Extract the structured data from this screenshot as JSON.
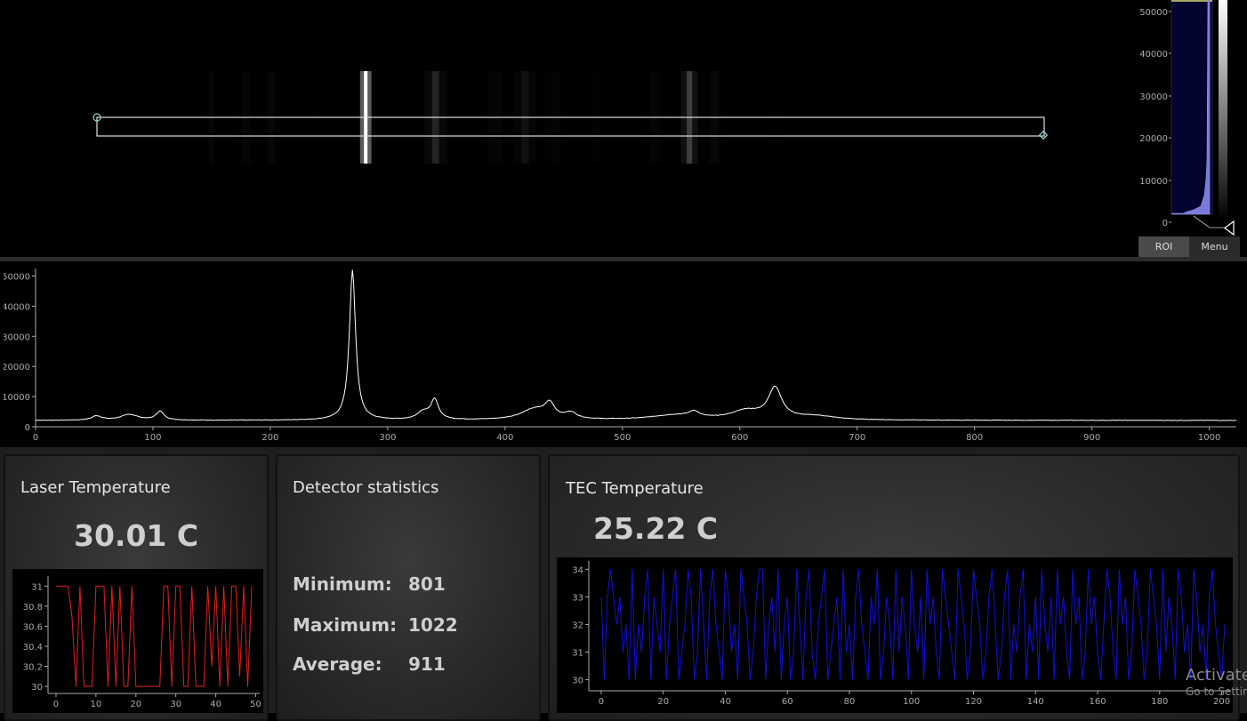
{
  "image_view": {
    "bands": [
      {
        "pos": 0.155,
        "w": 6,
        "i": 0.12
      },
      {
        "pos": 0.19,
        "w": 10,
        "i": 0.1
      },
      {
        "pos": 0.215,
        "w": 8,
        "i": 0.12
      },
      {
        "pos": 0.26,
        "w": 8,
        "i": 0.04
      },
      {
        "pos": 0.31,
        "w": 4,
        "i": 1.0
      },
      {
        "pos": 0.38,
        "w": 8,
        "i": 0.3
      },
      {
        "pos": 0.44,
        "w": 14,
        "i": 0.1
      },
      {
        "pos": 0.47,
        "w": 8,
        "i": 0.2
      },
      {
        "pos": 0.5,
        "w": 10,
        "i": 0.08
      },
      {
        "pos": 0.54,
        "w": 12,
        "i": 0.06
      },
      {
        "pos": 0.6,
        "w": 10,
        "i": 0.08
      },
      {
        "pos": 0.635,
        "w": 6,
        "i": 0.42
      },
      {
        "pos": 0.66,
        "w": 10,
        "i": 0.12
      },
      {
        "pos": 0.72,
        "w": 20,
        "i": 0.04
      }
    ]
  },
  "histogram": {
    "ticks": [
      "50000",
      "40000",
      "30000",
      "20000",
      "10000",
      "0"
    ],
    "roi_label": "ROI",
    "menu_label": "Menu",
    "accent": "#0a0a3a"
  },
  "chart_data": [
    {
      "type": "line",
      "id": "spectrum",
      "xlim": [
        0,
        1023
      ],
      "ylim": [
        0,
        52500
      ],
      "xticks": [
        0,
        100,
        200,
        300,
        400,
        500,
        600,
        700,
        800,
        900,
        1000
      ],
      "yticks": [
        0,
        10000,
        20000,
        30000,
        40000,
        50000
      ],
      "color": "#ffffff",
      "baseline": 2100,
      "peaks": [
        {
          "x": 52,
          "h": 1400,
          "w": 5
        },
        {
          "x": 80,
          "h": 1900,
          "w": 9
        },
        {
          "x": 106,
          "h": 2900,
          "w": 4
        },
        {
          "x": 270,
          "h": 49800,
          "w": 3.2
        },
        {
          "x": 330,
          "h": 2500,
          "w": 6
        },
        {
          "x": 340,
          "h": 6500,
          "w": 4
        },
        {
          "x": 425,
          "h": 3500,
          "w": 14
        },
        {
          "x": 438,
          "h": 4500,
          "w": 5
        },
        {
          "x": 456,
          "h": 2000,
          "w": 6
        },
        {
          "x": 545,
          "h": 1600,
          "w": 25
        },
        {
          "x": 561,
          "h": 1800,
          "w": 5
        },
        {
          "x": 605,
          "h": 2800,
          "w": 15
        },
        {
          "x": 630,
          "h": 10200,
          "w": 7
        },
        {
          "x": 665,
          "h": 1200,
          "w": 20
        }
      ]
    },
    {
      "type": "line",
      "id": "laser-temperature",
      "xlim": [
        -2,
        51
      ],
      "ylim": [
        29.93,
        31.1
      ],
      "xticks": [
        0,
        10,
        20,
        30,
        40,
        50
      ],
      "yticks": [
        30,
        30.2,
        30.4,
        30.6,
        30.8,
        31
      ],
      "yticklabels": [
        "30",
        "30.2",
        "30.4",
        "30.6",
        "30.8",
        "31"
      ],
      "color": "#e02020",
      "x": [
        0,
        1,
        2,
        3,
        4,
        5,
        6,
        7,
        8,
        9,
        10,
        11,
        12,
        13,
        14,
        15,
        16,
        17,
        18,
        19,
        20,
        21,
        22,
        23,
        24,
        25,
        26,
        27,
        28,
        29,
        30,
        31,
        32,
        33,
        34,
        35,
        36,
        37,
        38,
        39,
        40,
        41,
        42,
        43,
        44,
        45,
        46,
        47,
        48,
        49
      ],
      "y": [
        31,
        31,
        31,
        31,
        30.7,
        30,
        31,
        30,
        30,
        30,
        31,
        31,
        31,
        30,
        31,
        30,
        31,
        30,
        30,
        31,
        30,
        30,
        30,
        30,
        30,
        30,
        30,
        31,
        31,
        30,
        31,
        31,
        30,
        30,
        31,
        30,
        30,
        30,
        31,
        30.2,
        31,
        30,
        31,
        30,
        31,
        31,
        30.1,
        31,
        30,
        31
      ]
    },
    {
      "type": "line",
      "id": "tec-temperature",
      "xlim": [
        -4,
        203
      ],
      "ylim": [
        29.6,
        34.3
      ],
      "xticks": [
        0,
        20,
        40,
        60,
        80,
        100,
        120,
        140,
        160,
        180,
        200
      ],
      "yticks": [
        30,
        31,
        32,
        33,
        34
      ],
      "color": "#1010dd",
      "y": [
        33,
        30,
        33,
        34,
        33,
        32,
        33,
        31,
        32,
        30,
        34,
        30,
        32,
        31,
        33,
        34,
        30,
        33,
        32,
        31,
        34,
        30,
        32,
        33,
        34,
        30,
        31,
        32,
        34,
        33,
        30,
        31,
        34,
        32,
        30,
        33,
        34,
        32,
        31,
        30,
        34,
        33,
        31,
        32,
        30,
        34,
        33,
        32,
        30,
        31,
        33,
        34,
        34,
        30,
        32,
        33,
        31,
        34,
        30,
        32,
        33,
        30,
        31,
        34,
        32,
        30,
        33,
        34,
        31,
        30,
        32,
        33,
        34,
        30,
        31,
        32,
        33,
        30,
        34,
        31,
        32,
        30,
        33,
        34,
        32,
        31,
        30,
        33,
        32,
        34,
        30,
        31,
        33,
        32,
        30,
        34,
        31,
        33,
        32,
        30,
        34,
        32,
        31,
        33,
        30,
        34,
        32,
        33,
        31,
        30,
        34,
        33,
        32,
        31,
        30,
        34,
        33,
        32,
        30,
        31,
        34,
        33,
        32,
        30,
        31,
        33,
        34,
        32,
        30,
        31,
        33,
        34,
        30,
        32,
        31,
        33,
        34,
        30,
        32,
        31,
        33,
        30,
        34,
        32,
        31,
        33,
        30,
        34,
        32,
        33,
        31,
        30,
        34,
        32,
        33,
        30,
        31,
        34,
        32,
        33,
        31,
        30,
        32,
        34,
        33,
        31,
        30,
        34,
        32,
        33,
        30,
        31,
        34,
        33,
        32,
        30,
        31,
        34,
        33,
        32,
        30,
        34,
        31,
        33,
        32,
        30,
        34,
        33,
        31,
        32,
        30,
        34,
        33,
        31,
        32,
        30,
        33,
        34,
        32,
        31,
        30,
        32
      ]
    }
  ],
  "laser_card": {
    "title": "Laser Temperature",
    "value": "30.01 C"
  },
  "detector_card": {
    "title": "Detector statistics",
    "min_label": "Minimum:",
    "min_value": "801",
    "max_label": "Maximum:",
    "max_value": "1022",
    "avg_label": "Average:",
    "avg_value": "911"
  },
  "tec_card": {
    "title": "TEC Temperature",
    "value": "25.22 C"
  },
  "watermark": {
    "line1": "Activate Windows",
    "line2": "Go to Settings to activate Windows."
  }
}
